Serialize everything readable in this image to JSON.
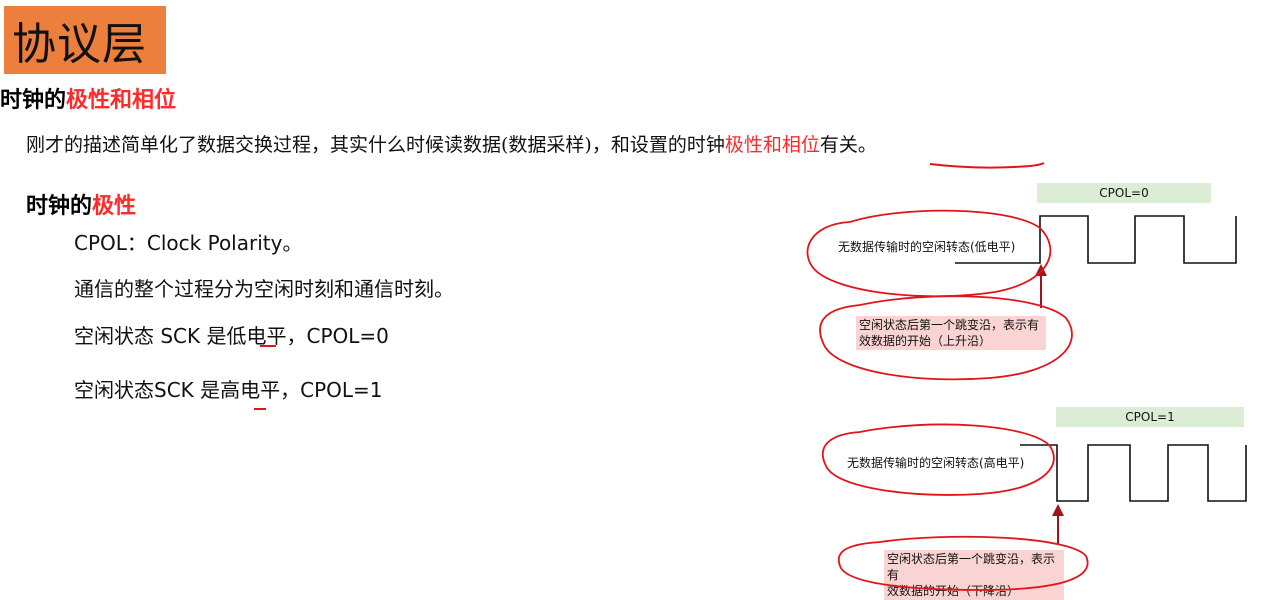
{
  "title": "协议层",
  "section_heading": {
    "black": "时钟的",
    "red": "极性和相位"
  },
  "intro": {
    "before": "刚才的描述简单化了数据交换过程，其实什么时候读数据(数据采样)，和设置的时钟",
    "highlight": "极性和相位",
    "after": "有关。"
  },
  "polarity_heading": {
    "black": "时钟的",
    "red": "极性"
  },
  "lines": {
    "cpol_def": "CPOL：Clock Polarity。",
    "phases": "通信的整个过程分为空闲时刻和通信时刻。",
    "idle_low": {
      "before": "空闲状态 SCK 是",
      "underlined": "低",
      "after": "电平，CPOL=0"
    },
    "idle_high": {
      "before": "空闲状态SCK 是",
      "underlined": "高",
      "after": "电平，CPOL=1"
    }
  },
  "diagram_cpol0": {
    "label": "CPOL=0",
    "state": "无数据传输时的空闲转态(低电平)",
    "note_line1": "空闲状态后第一个跳变沿，表示有",
    "note_line2": "效数据的开始（上升沿）"
  },
  "diagram_cpol1": {
    "label": "CPOL=1",
    "state": "无数据传输时的空闲转态(高电平)",
    "note_line1": "空闲状态后第一个跳变沿，表示有",
    "note_line2": "效数据的开始（下降沿）"
  },
  "colors": {
    "title_bg": "#ec7f3b",
    "accent_red": "#ff2b2b",
    "annotation_red": "#e0141a",
    "arrow_dark_red": "#a01515",
    "label_green": "#dbeed5",
    "note_pink": "#f9d4d3"
  }
}
